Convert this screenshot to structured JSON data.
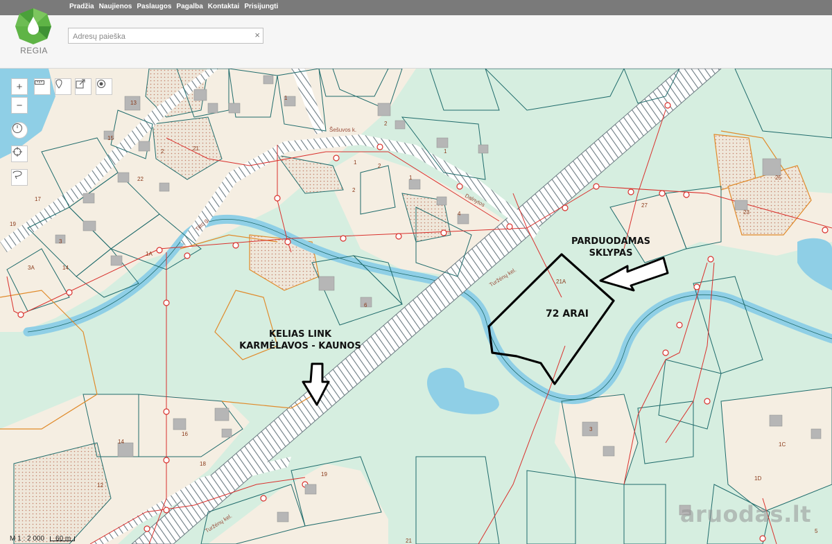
{
  "nav": {
    "items": [
      "Pradžia",
      "Naujienos",
      "Paslaugos",
      "Pagalba",
      "Kontaktai",
      "Prisijungti"
    ]
  },
  "header": {
    "logo_text": "REGIA",
    "search_placeholder": "Adresų paieška",
    "clear_icon": "×"
  },
  "controls": [
    "zoom-in",
    "zoom-out",
    "measure",
    "location-pin",
    "share",
    "target",
    "history",
    "locate",
    "draw-area"
  ],
  "map": {
    "parcel_labels": [
      "13",
      "15",
      "2",
      "21",
      "22",
      "17",
      "19",
      "3",
      "14",
      "1",
      "3A",
      "1A",
      "2",
      "1",
      "1",
      "2",
      "4",
      "6",
      "21A",
      "25",
      "23",
      "27",
      "14",
      "16",
      "18",
      "12",
      "19",
      "1C",
      "1D",
      "3",
      "21",
      "2",
      "1",
      "5"
    ],
    "street_labels": [
      "Šešuvos k.",
      "Dalnytos",
      "Tilto g.",
      "Turžėnų kel.",
      "Turžėnų kel."
    ],
    "annotations": {
      "sale": [
        "PARDUODAMAS",
        "SKLYPAS"
      ],
      "area": "72 ARAI",
      "road": [
        "KELIAS LINK",
        "KARMĖLAVOS - KAUNOS"
      ]
    },
    "scale": {
      "ratio": "M 1 : 2 000",
      "distance": "60 m"
    },
    "watermark": "aruodas.lt"
  },
  "colors": {
    "nav_bg": "#7a7a7a",
    "map_green": "#d6eee0",
    "river": "#8fcfe6",
    "boundary": "#1f6b6b",
    "orange": "#e08a2a",
    "red": "#d9302c"
  }
}
